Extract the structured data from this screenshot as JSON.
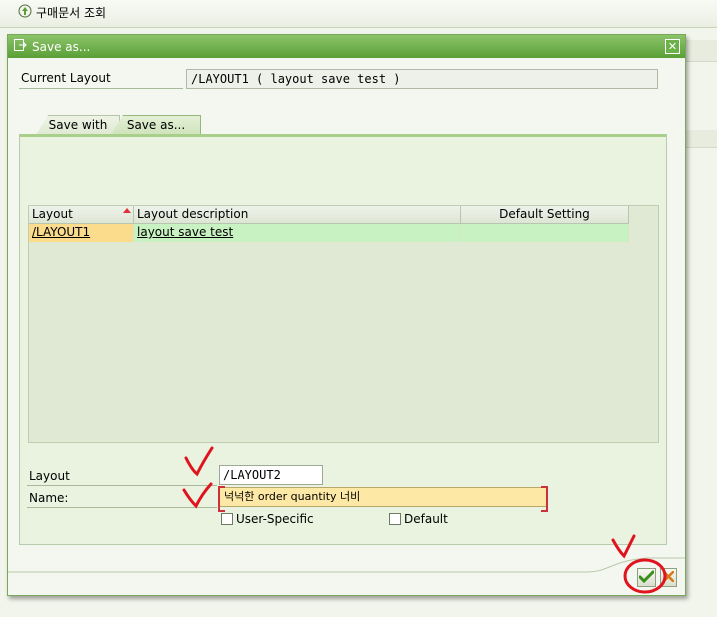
{
  "background_window": {
    "title": "구매문서 조회",
    "icon": "document-search-icon"
  },
  "dialog": {
    "title": "Save as...",
    "title_icon": "save-as-icon",
    "close_icon": "close-icon",
    "current_layout": {
      "label": "Current Layout",
      "value": "/LAYOUT1 ( layout save test )"
    },
    "tabs": [
      {
        "label": "Save with",
        "active": false
      },
      {
        "label": "Save as...",
        "active": true
      }
    ],
    "table": {
      "columns": [
        "Layout",
        "Layout description",
        "Default Setting"
      ],
      "rows": [
        {
          "layout": "/LAYOUT1",
          "description": "layout save test",
          "default": ""
        }
      ]
    },
    "form": {
      "layout_label": "Layout",
      "layout_value": "/LAYOUT2",
      "name_label": "Name:",
      "name_value": "넉넉한 order quantity 너비",
      "user_specific_label": "User-Specific",
      "default_label": "Default"
    },
    "buttons": {
      "ok_icon": "checkmark-icon",
      "cancel_icon": "cancel-icon"
    }
  },
  "colors": {
    "title_bar": "#5a9f36",
    "selected_cell": "#fbdc8c",
    "row_bg": "#c9f2c2",
    "required_field": "#fde9a5",
    "annotation": "#e0141e"
  }
}
